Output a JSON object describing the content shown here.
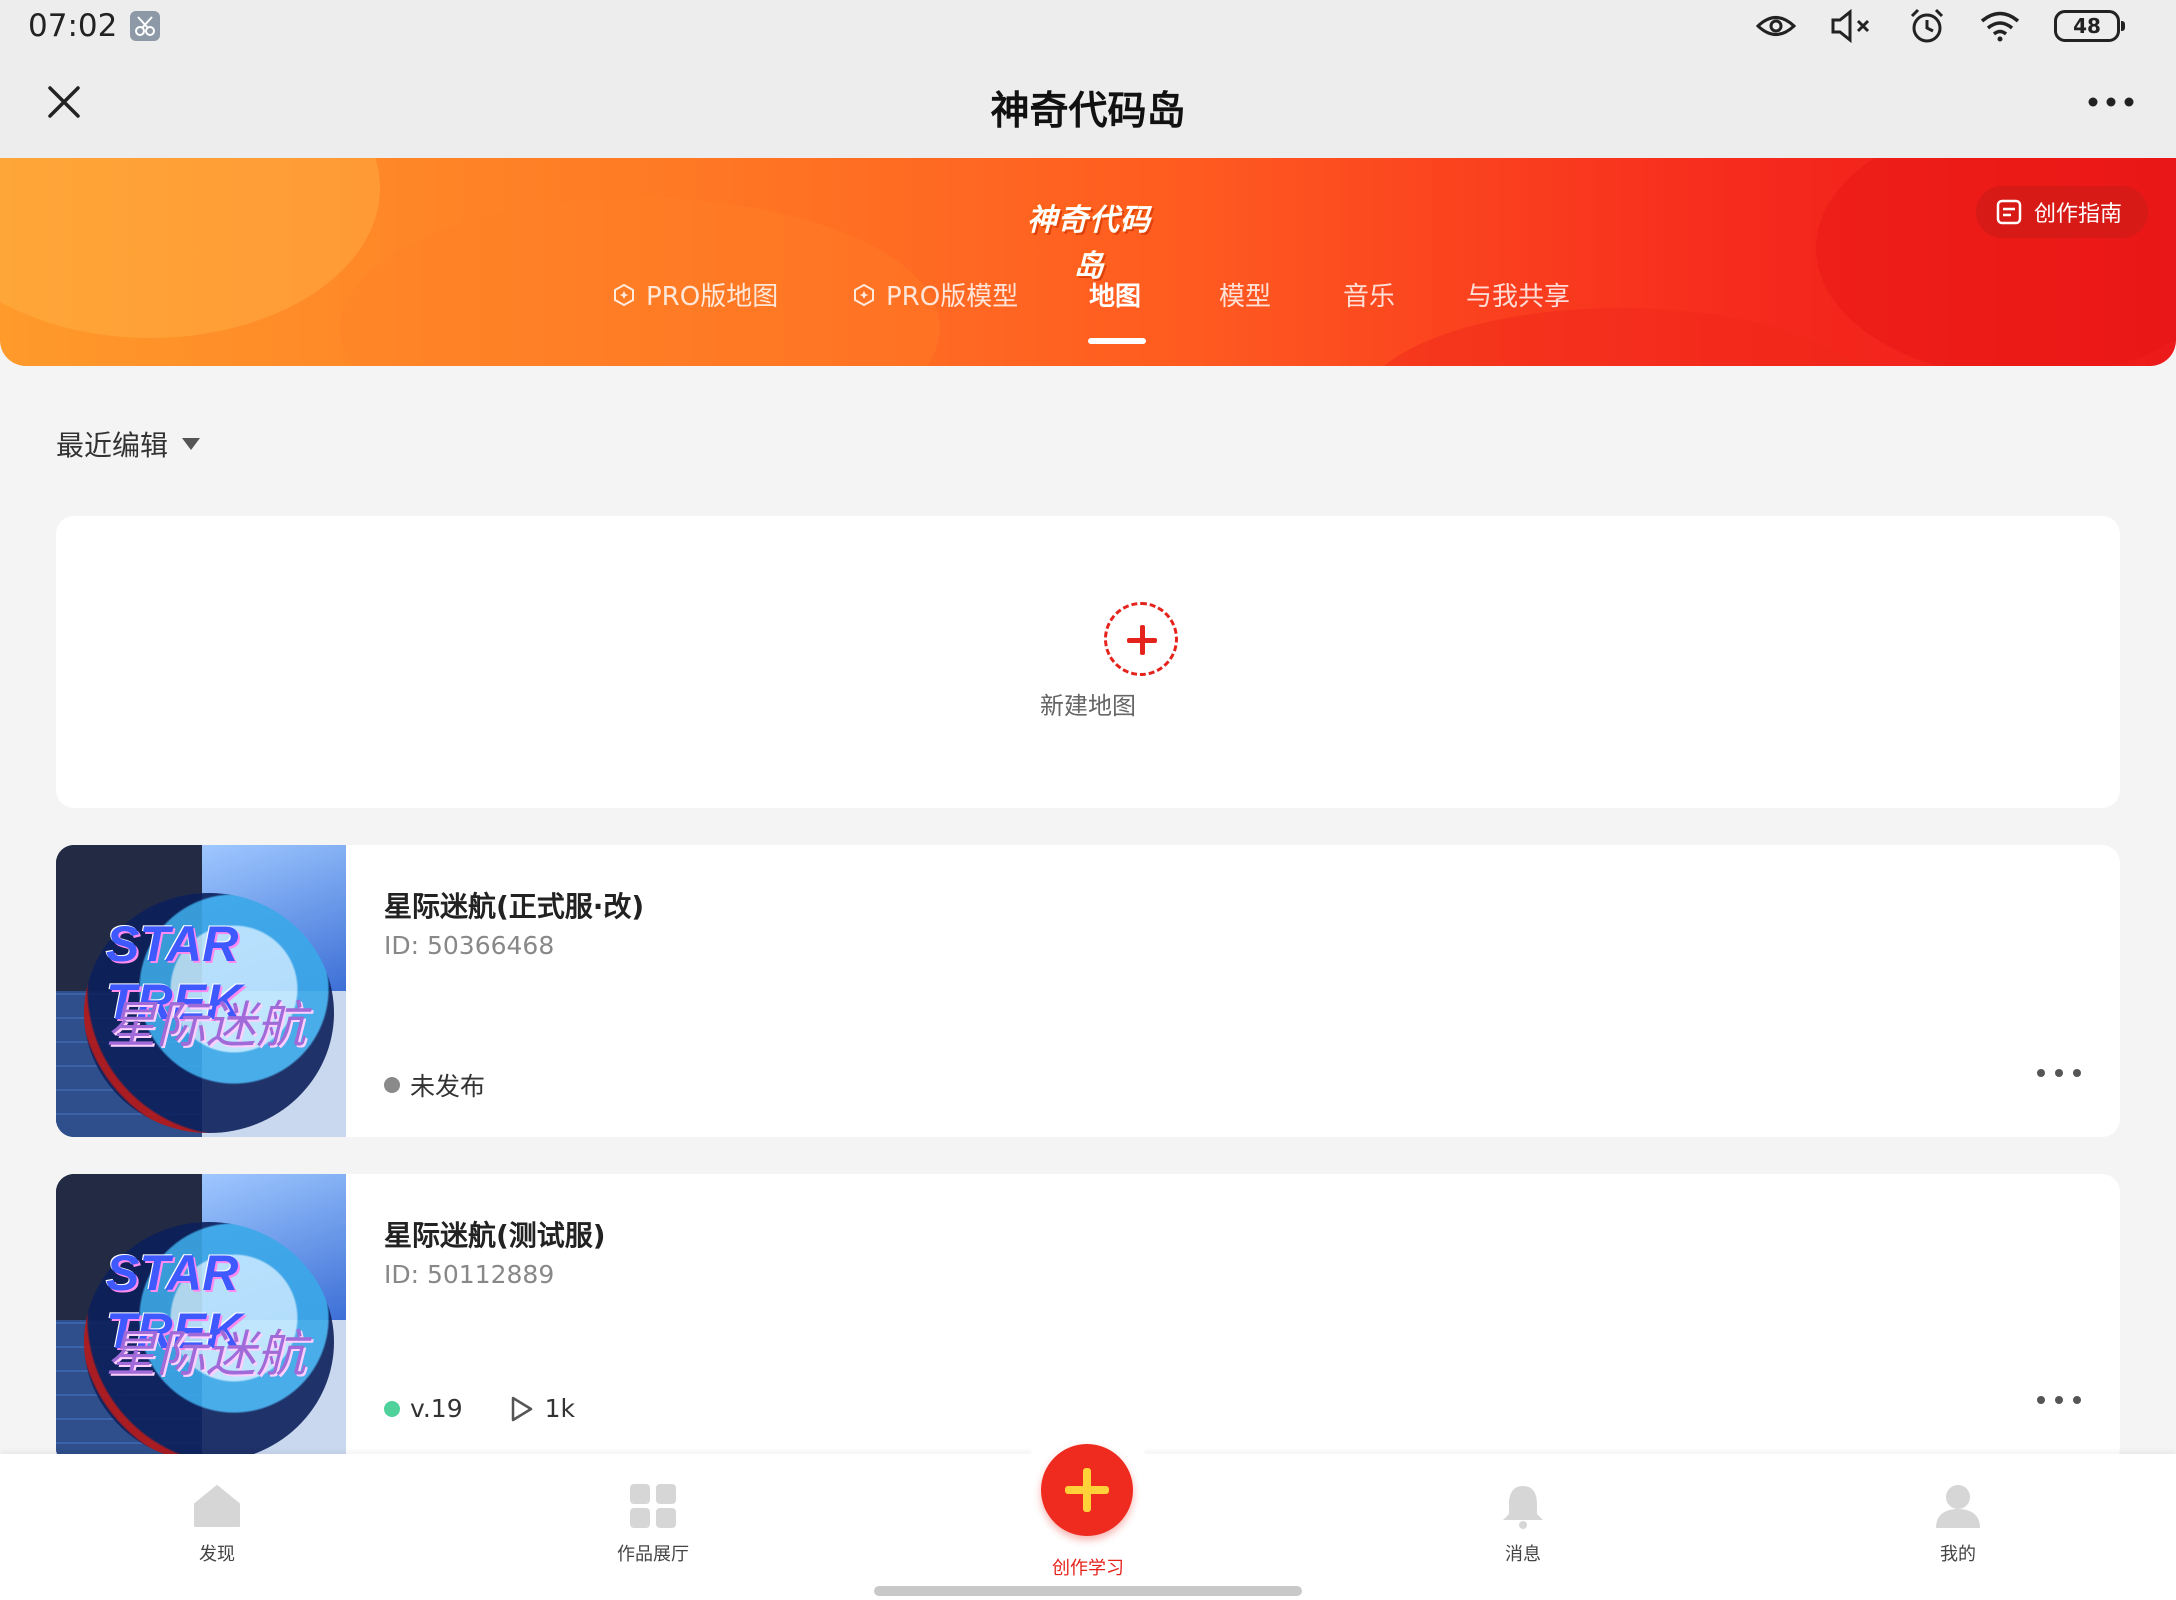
{
  "status_bar": {
    "time": "07:02",
    "battery": "48"
  },
  "title_bar": {
    "title": "神奇代码岛"
  },
  "banner": {
    "logo_text": "神奇代码岛",
    "guide_label": "创作指南",
    "tabs": [
      {
        "label": "PRO版地图",
        "pro": true
      },
      {
        "label": "PRO版模型",
        "pro": true
      },
      {
        "label": "地图",
        "active": true
      },
      {
        "label": "模型"
      },
      {
        "label": "音乐"
      },
      {
        "label": "与我共享"
      }
    ]
  },
  "sort": {
    "label": "最近编辑"
  },
  "new_map": {
    "label": "新建地图"
  },
  "maps": [
    {
      "title": "星际迷航(正式服·改)",
      "id": "ID: 50366468",
      "status": "未发布",
      "status_color": "#8a8a8a"
    },
    {
      "title": "星际迷航(测试服)",
      "id": "ID: 50112889",
      "version": "v.19",
      "status_color": "#4fd19b",
      "plays": "1k"
    }
  ],
  "thumb_text": {
    "en": "STAR TREK",
    "zh": "星际迷航"
  },
  "bottom_nav": [
    {
      "label": "发现",
      "icon": "home-icon"
    },
    {
      "label": "作品展厅",
      "icon": "grid-icon"
    },
    {
      "label": "创作学习",
      "icon": "plus-icon",
      "active": true
    },
    {
      "label": "消息",
      "icon": "bell-icon"
    },
    {
      "label": "我的",
      "icon": "user-icon"
    }
  ],
  "colors": {
    "accent": "#e5231d",
    "fab": "#ef2a1e",
    "published_dot": "#4fd19b",
    "unpublished_dot": "#8a8a8a"
  }
}
